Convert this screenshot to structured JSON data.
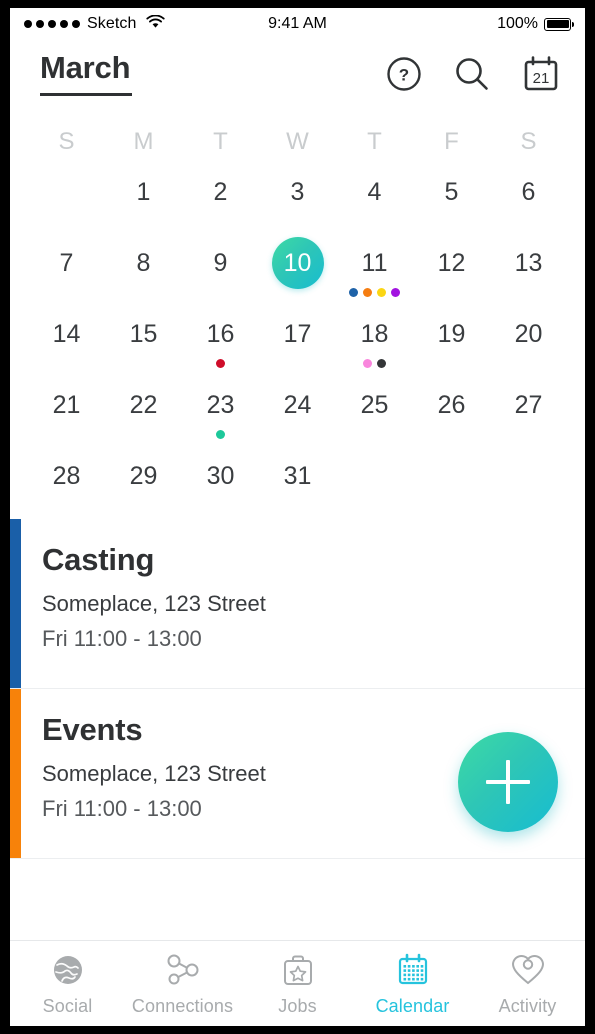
{
  "status_bar": {
    "signal_dots": 5,
    "carrier": "Sketch",
    "wifi_icon": "wifi-icon",
    "time": "9:41 AM",
    "battery_percent": "100%",
    "battery_level": 100
  },
  "header": {
    "title": "March",
    "actions": [
      {
        "name": "help-icon",
        "label": "Help"
      },
      {
        "name": "search-icon",
        "label": "Search"
      },
      {
        "name": "calendar-day-icon",
        "label": "21"
      }
    ],
    "calendar_icon_day": "21"
  },
  "calendar": {
    "month": "March",
    "day_headers": [
      "S",
      "M",
      "T",
      "W",
      "T",
      "F",
      "S"
    ],
    "selected_day": 10,
    "weeks": [
      [
        {
          "day": ""
        },
        {
          "day": "1"
        },
        {
          "day": "2"
        },
        {
          "day": "3"
        },
        {
          "day": "4"
        },
        {
          "day": "5"
        },
        {
          "day": "6"
        }
      ],
      [
        {
          "day": "7"
        },
        {
          "day": "8"
        },
        {
          "day": "9"
        },
        {
          "day": "10",
          "selected": true
        },
        {
          "day": "11",
          "dots": [
            "#1e62a8",
            "#f57d12",
            "#fbd614",
            "#a213e0"
          ]
        },
        {
          "day": "12"
        },
        {
          "day": "13"
        }
      ],
      [
        {
          "day": "14"
        },
        {
          "day": "15"
        },
        {
          "day": "16",
          "dots": [
            "#cf0d2a"
          ]
        },
        {
          "day": "17"
        },
        {
          "day": "18",
          "dots": [
            "#f986dd",
            "#343638"
          ]
        },
        {
          "day": "19"
        },
        {
          "day": "20"
        }
      ],
      [
        {
          "day": "21"
        },
        {
          "day": "22"
        },
        {
          "day": "23",
          "dots": [
            "#1dc89a"
          ]
        },
        {
          "day": "24"
        },
        {
          "day": "25"
        },
        {
          "day": "26"
        },
        {
          "day": "27"
        }
      ],
      [
        {
          "day": "28"
        },
        {
          "day": "29"
        },
        {
          "day": "30"
        },
        {
          "day": "31"
        },
        {
          "day": ""
        },
        {
          "day": ""
        },
        {
          "day": ""
        }
      ]
    ]
  },
  "events": [
    {
      "title": "Casting",
      "place": "Someplace, 123 Street",
      "time": "Fri 11:00 - 13:00",
      "accent": "#1a5fa8"
    },
    {
      "title": "Events",
      "place": "Someplace, 123 Street",
      "time": "Fri 11:00 - 13:00",
      "accent": "#f7820a"
    }
  ],
  "fab": {
    "name": "add-event-button",
    "label": "+"
  },
  "tabbar": {
    "active_color": "#25c3dd",
    "inactive_color": "#a8abad",
    "items": [
      {
        "label": "Social",
        "icon": "globe-icon",
        "active": false
      },
      {
        "label": "Connections",
        "icon": "share-icon",
        "active": false
      },
      {
        "label": "Jobs",
        "icon": "briefcase-icon",
        "active": false
      },
      {
        "label": "Calendar",
        "icon": "calendar-icon",
        "active": true
      },
      {
        "label": "Activity",
        "icon": "heart-pin-icon",
        "active": false
      }
    ]
  }
}
